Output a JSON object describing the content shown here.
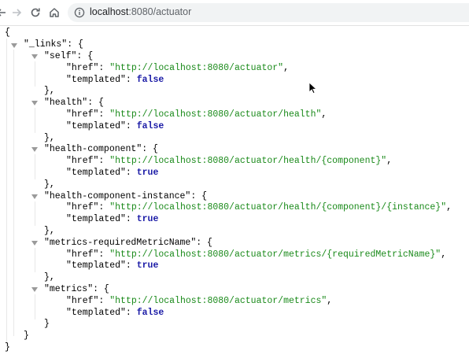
{
  "browser": {
    "url_host": "localhost",
    "url_path": ":8080/actuator",
    "icons": [
      "back-icon",
      "forward-icon",
      "reload-icon",
      "home-icon",
      "site-info-icon"
    ]
  },
  "json": {
    "open_root": "{",
    "links_key": "\"_links\"",
    "entries": [
      {
        "key": "\"self\"",
        "href": "\"http://localhost:8080/actuator\"",
        "href_comma": ",",
        "templated": "false",
        "close": "},"
      },
      {
        "key": "\"health\"",
        "href": "\"http://localhost:8080/actuator/health\"",
        "href_comma": ",",
        "templated": "false",
        "close": "},"
      },
      {
        "key": "\"health-component\"",
        "href": "\"http://localhost:8080/actuator/health/{component}\"",
        "href_comma": ",",
        "templated": "true",
        "close": "},"
      },
      {
        "key": "\"health-component-instance\"",
        "href": "\"http://localhost:8080/actuator/health/{component}/{instance}\"",
        "href_comma": ",",
        "templated": "true",
        "close": "},"
      },
      {
        "key": "\"metrics-requiredMetricName\"",
        "href": "\"http://localhost:8080/actuator/metrics/{requiredMetricName}\"",
        "href_comma": ",",
        "templated": "true",
        "close": "},"
      },
      {
        "key": "\"metrics\"",
        "href": "\"http://localhost:8080/actuator/metrics\"",
        "href_comma": ",",
        "templated": "false",
        "close": "}"
      }
    ],
    "href_key": "\"href\"",
    "templated_key": "\"templated\"",
    "links_close": "}",
    "close_root": "}"
  }
}
